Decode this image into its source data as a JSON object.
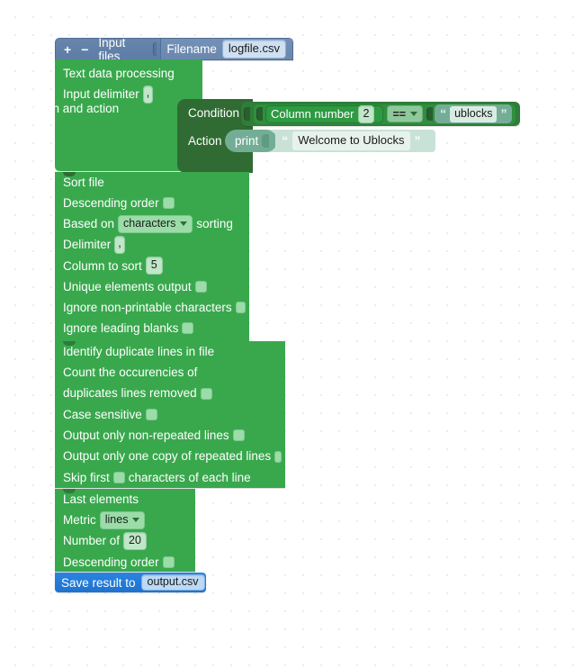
{
  "header": {
    "add_label": "+",
    "remove_label": "−",
    "title": "Input files",
    "filename_label": "Filename",
    "filename_value": "logfile.csv"
  },
  "text_processing": {
    "title": "Text data processing",
    "input_delimiter_label": "Input delimiter",
    "input_delimiter_value": ",",
    "condition_action_label": "Condition and action"
  },
  "condition_block": {
    "condition_label": "Condition",
    "action_label": "Action",
    "expression": {
      "left_label": "Column number",
      "left_value": "2",
      "operator": "==",
      "right_quote_open": "“",
      "right_value": "ublocks",
      "right_quote_close": "”"
    },
    "action": {
      "command": "print",
      "quote_open": "“",
      "value": "Welcome to Ublocks",
      "quote_close": "”"
    }
  },
  "sort_block": {
    "title": "Sort file",
    "descending_order_label": "Descending order",
    "descending_order_checked": false,
    "based_on_prefix": "Based on",
    "based_on_value": "characters",
    "based_on_suffix": "sorting",
    "delimiter_label": "Delimiter",
    "delimiter_value": ",",
    "column_to_sort_label": "Column to sort",
    "column_to_sort_value": "5",
    "unique_elements_label": "Unique elements output",
    "unique_elements_checked": false,
    "ignore_nonprintable_label": "Ignore non-printable characters",
    "ignore_nonprintable_checked": false,
    "ignore_leading_blanks_label": "Ignore leading blanks",
    "ignore_leading_blanks_checked": false
  },
  "duplicates_block": {
    "title": "Identify duplicate lines in file",
    "count_occurrences_label": "Count the occurencies of",
    "duplicates_removed_label": "duplicates lines removed",
    "duplicates_removed_checked": false,
    "case_sensitive_label": "Case sensitive",
    "case_sensitive_checked": false,
    "non_repeated_label": "Output only non-repeated lines",
    "non_repeated_checked": false,
    "one_copy_label": "Output only one copy of repeated lines",
    "one_copy_checked": false,
    "skip_first_prefix": "Skip first",
    "skip_first_value": "",
    "skip_first_suffix": "characters of each line"
  },
  "last_elements_block": {
    "title": "Last elements",
    "metric_label": "Metric",
    "metric_value": "lines",
    "number_of_label": "Number of",
    "number_of_value": "20",
    "descending_order_label": "Descending order",
    "descending_order_checked": false
  },
  "save_block": {
    "label": "Save result to",
    "filename": "output.csv"
  },
  "colors": {
    "header_blue": "#5d7da6",
    "block_green": "#39a84d",
    "panel_dark_green": "#2f6b32",
    "string_teal": "#74ad96",
    "save_blue": "#1f72cf"
  }
}
